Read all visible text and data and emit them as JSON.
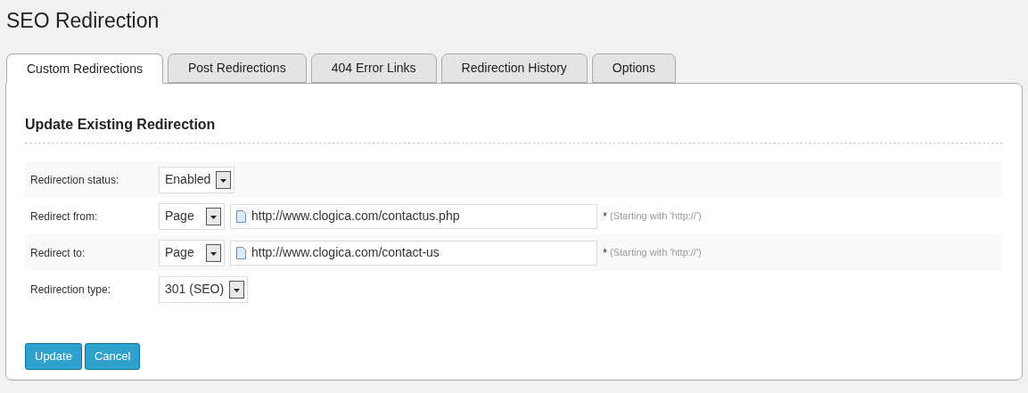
{
  "page_title": "SEO Redirection",
  "tabs": [
    {
      "label": "Custom Redirections",
      "selected": true
    },
    {
      "label": "Post Redirections",
      "selected": false
    },
    {
      "label": "404 Error Links",
      "selected": false
    },
    {
      "label": "Redirection History",
      "selected": false
    },
    {
      "label": "Options",
      "selected": false
    }
  ],
  "section_title": "Update Existing Redirection",
  "fields": [
    {
      "kind": "select",
      "label": "Redirection status:",
      "value": "Enabled"
    },
    {
      "kind": "select-url",
      "label": "Redirect from:",
      "value": "Page",
      "url": "http://www.clogica.com/contactus.php",
      "required_mark": "*",
      "hint": "(Starting with 'http://')"
    },
    {
      "kind": "select-url",
      "label": "Redirect to:",
      "value": "Page",
      "url": "http://www.clogica.com/contact-us",
      "required_mark": "*",
      "hint": "(Starting with 'http://')"
    },
    {
      "kind": "select",
      "label": "Redirection type:",
      "value": "301 (SEO)"
    }
  ],
  "buttons": [
    "Update",
    "Cancel"
  ]
}
